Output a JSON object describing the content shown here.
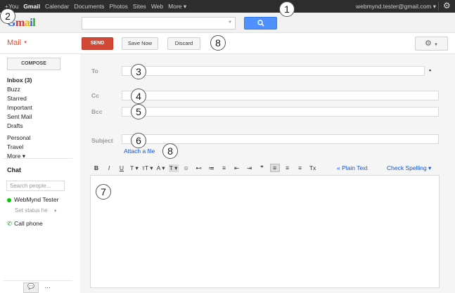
{
  "topbar": {
    "nav": [
      "+You",
      "Gmail",
      "Calendar",
      "Documents",
      "Photos",
      "Sites",
      "Web",
      "More ▾"
    ],
    "account": "webmynd.tester@gmail.com ▾"
  },
  "header": {
    "search_placeholder": "",
    "search_button": "🔍"
  },
  "actionbar": {
    "mail_label": "Mail",
    "send": "SEND",
    "save": "Save Now",
    "discard": "Discard",
    "settings": "⚙"
  },
  "sidebar": {
    "compose": "COMPOSE",
    "items": [
      "Inbox (3)",
      "Buzz",
      "Starred",
      "Important",
      "Sent Mail",
      "Drafts"
    ],
    "labels": [
      "Personal",
      "Travel",
      "More ▾"
    ],
    "chat_title": "Chat",
    "chat_search_placeholder": "Search people...",
    "chat_user": "WebMynd Tester",
    "status": "Set status he",
    "call": "Call phone"
  },
  "compose_form": {
    "to_label": "To",
    "cc_label": "Cc",
    "bcc_label": "Bcc",
    "subject_label": "Subject",
    "attach": "Attach a file",
    "plain_text": "« Plain Text",
    "spell_check": "Check Spelling ▾",
    "toolbar": [
      "B",
      "I",
      "U",
      "T ▾",
      "тT ▾",
      "A ▾",
      "T ▾",
      "☺",
      "⊷",
      "≔",
      "≡",
      "⇤",
      "⇥",
      "❞",
      "≡",
      "≡",
      "≡",
      "Tx"
    ]
  },
  "callouts": [
    "1",
    "2",
    "3",
    "4",
    "5",
    "6",
    "7",
    "8",
    "8"
  ]
}
